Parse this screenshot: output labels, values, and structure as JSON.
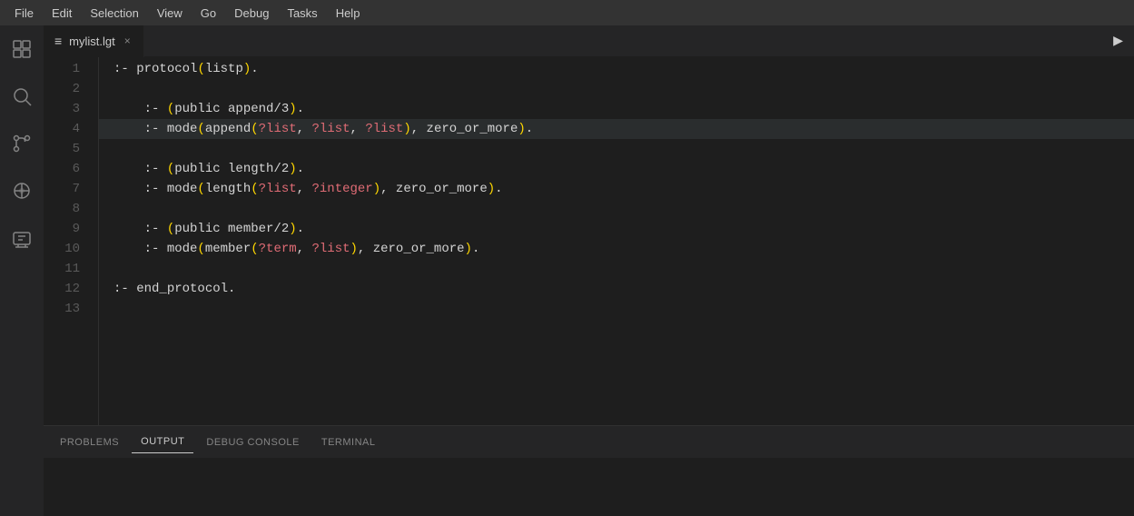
{
  "menubar": {
    "items": [
      {
        "id": "file",
        "label": "File"
      },
      {
        "id": "edit",
        "label": "Edit"
      },
      {
        "id": "selection",
        "label": "Selection"
      },
      {
        "id": "view",
        "label": "View"
      },
      {
        "id": "go",
        "label": "Go"
      },
      {
        "id": "debug",
        "label": "Debug"
      },
      {
        "id": "tasks",
        "label": "Tasks"
      },
      {
        "id": "help",
        "label": "Help"
      }
    ]
  },
  "tab": {
    "filename": "mylist.lgt",
    "close_label": "×"
  },
  "panel": {
    "tabs": [
      {
        "id": "problems",
        "label": "PROBLEMS"
      },
      {
        "id": "output",
        "label": "OUTPUT"
      },
      {
        "id": "debug-console",
        "label": "DEBUG CONSOLE"
      },
      {
        "id": "terminal",
        "label": "TERMINAL"
      }
    ]
  },
  "lines": [
    {
      "num": 1,
      "content": ":- protocol(listp)."
    },
    {
      "num": 2,
      "content": ""
    },
    {
      "num": 3,
      "content": "    :- (public append/3)."
    },
    {
      "num": 4,
      "content": "    :- mode(append(?list, ?list, ?list), zero_or_more)."
    },
    {
      "num": 5,
      "content": ""
    },
    {
      "num": 6,
      "content": "    :- (public length/2)."
    },
    {
      "num": 7,
      "content": "    :- mode(length(?list, ?integer), zero_or_more)."
    },
    {
      "num": 8,
      "content": ""
    },
    {
      "num": 9,
      "content": "    :- (public member/2)."
    },
    {
      "num": 10,
      "content": "    :- mode(member(?term, ?list), zero_or_more)."
    },
    {
      "num": 11,
      "content": ""
    },
    {
      "num": 12,
      "content": ":- end_protocol."
    },
    {
      "num": 13,
      "content": ""
    }
  ]
}
